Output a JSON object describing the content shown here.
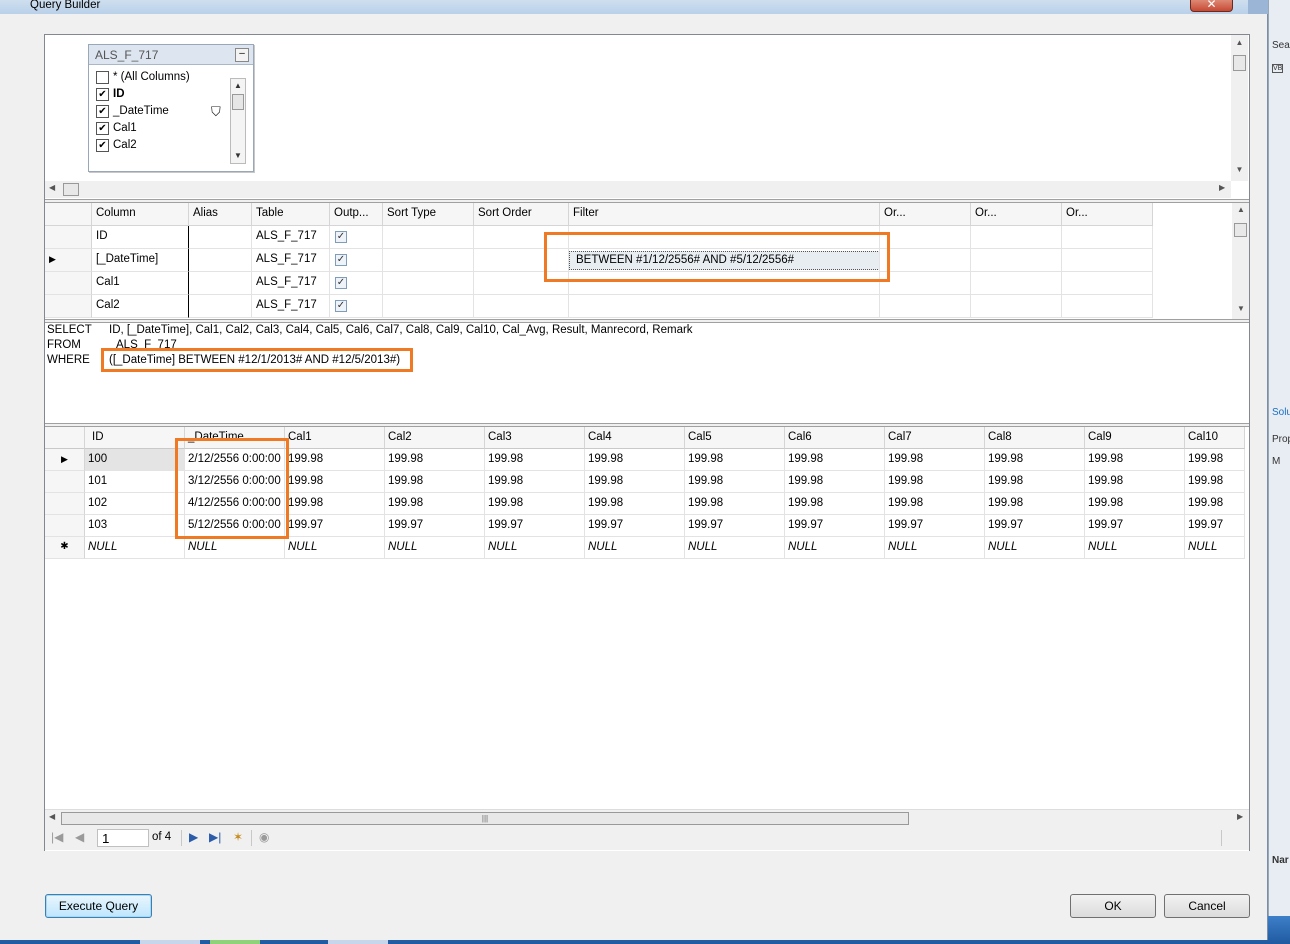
{
  "window": {
    "title": "Query Builder",
    "close_glyph": "✕"
  },
  "diagram": {
    "table_name": "ALS_F_717",
    "minimize_glyph": "–",
    "columns": [
      {
        "label": "* (All Columns)",
        "checked": false,
        "bold": false,
        "filter": false
      },
      {
        "label": "ID",
        "checked": true,
        "bold": true,
        "filter": false
      },
      {
        "label": "_DateTime",
        "checked": true,
        "bold": false,
        "filter": true
      },
      {
        "label": "Cal1",
        "checked": true,
        "bold": false,
        "filter": false
      },
      {
        "label": "Cal2",
        "checked": true,
        "bold": false,
        "filter": false
      }
    ]
  },
  "criteria": {
    "headers": [
      "Column",
      "Alias",
      "Table",
      "Outp...",
      "Sort Type",
      "Sort Order",
      "Filter",
      "Or...",
      "Or...",
      "Or..."
    ],
    "rows": [
      {
        "column": "ID",
        "alias": "",
        "table": "ALS_F_717",
        "output": true,
        "filter": "",
        "current": false
      },
      {
        "column": "[_DateTime]",
        "alias": "",
        "table": "ALS_F_717",
        "output": true,
        "filter": "BETWEEN #1/12/2556# AND #5/12/2556#",
        "current": true
      },
      {
        "column": "Cal1",
        "alias": "",
        "table": "ALS_F_717",
        "output": true,
        "filter": "",
        "current": false
      },
      {
        "column": "Cal2",
        "alias": "",
        "table": "ALS_F_717",
        "output": true,
        "filter": "",
        "current": false
      }
    ]
  },
  "sql": {
    "select_kw": "SELECT",
    "select_text": "ID, [_DateTime], Cal1, Cal2, Cal3, Cal4, Cal5, Cal6, Cal7, Cal8, Cal9, Cal10, Cal_Avg, Result, Manrecord, Remark",
    "from_kw": "FROM",
    "from_text": "ALS_F_717",
    "where_kw": "WHERE",
    "where_text": "([_DateTime] BETWEEN #12/1/2013# AND #12/5/2013#)"
  },
  "results": {
    "headers": [
      "ID",
      "_DateTime",
      "Cal1",
      "Cal2",
      "Cal3",
      "Cal4",
      "Cal5",
      "Cal6",
      "Cal7",
      "Cal8",
      "Cal9",
      "Cal10"
    ],
    "rows": [
      [
        "100",
        "2/12/2556 0:00:00",
        "199.98",
        "199.98",
        "199.98",
        "199.98",
        "199.98",
        "199.98",
        "199.98",
        "199.98",
        "199.98",
        "199.98"
      ],
      [
        "101",
        "3/12/2556 0:00:00",
        "199.98",
        "199.98",
        "199.98",
        "199.98",
        "199.98",
        "199.98",
        "199.98",
        "199.98",
        "199.98",
        "199.98"
      ],
      [
        "102",
        "4/12/2556 0:00:00",
        "199.98",
        "199.98",
        "199.98",
        "199.98",
        "199.98",
        "199.98",
        "199.98",
        "199.98",
        "199.98",
        "199.98"
      ],
      [
        "103",
        "5/12/2556 0:00:00",
        "199.97",
        "199.97",
        "199.97",
        "199.97",
        "199.97",
        "199.97",
        "199.97",
        "199.97",
        "199.97",
        "199.97"
      ]
    ],
    "null_row": [
      "NULL",
      "NULL",
      "NULL",
      "NULL",
      "NULL",
      "NULL",
      "NULL",
      "NULL",
      "NULL",
      "NULL",
      "NULL",
      "NULL"
    ],
    "new_row_glyph": "✱",
    "current_row_glyph": "▶"
  },
  "navigator": {
    "page": "1",
    "of_text": "of 4"
  },
  "buttons": {
    "execute": "Execute Query",
    "ok": "OK",
    "cancel": "Cancel"
  },
  "colors": {
    "highlight": "#f07a23",
    "default_button": "#3c7fb1"
  },
  "background_ide": {
    "texts": [
      "Sea",
      "VB",
      "Solu",
      "Prop",
      "M",
      "Nar"
    ]
  }
}
